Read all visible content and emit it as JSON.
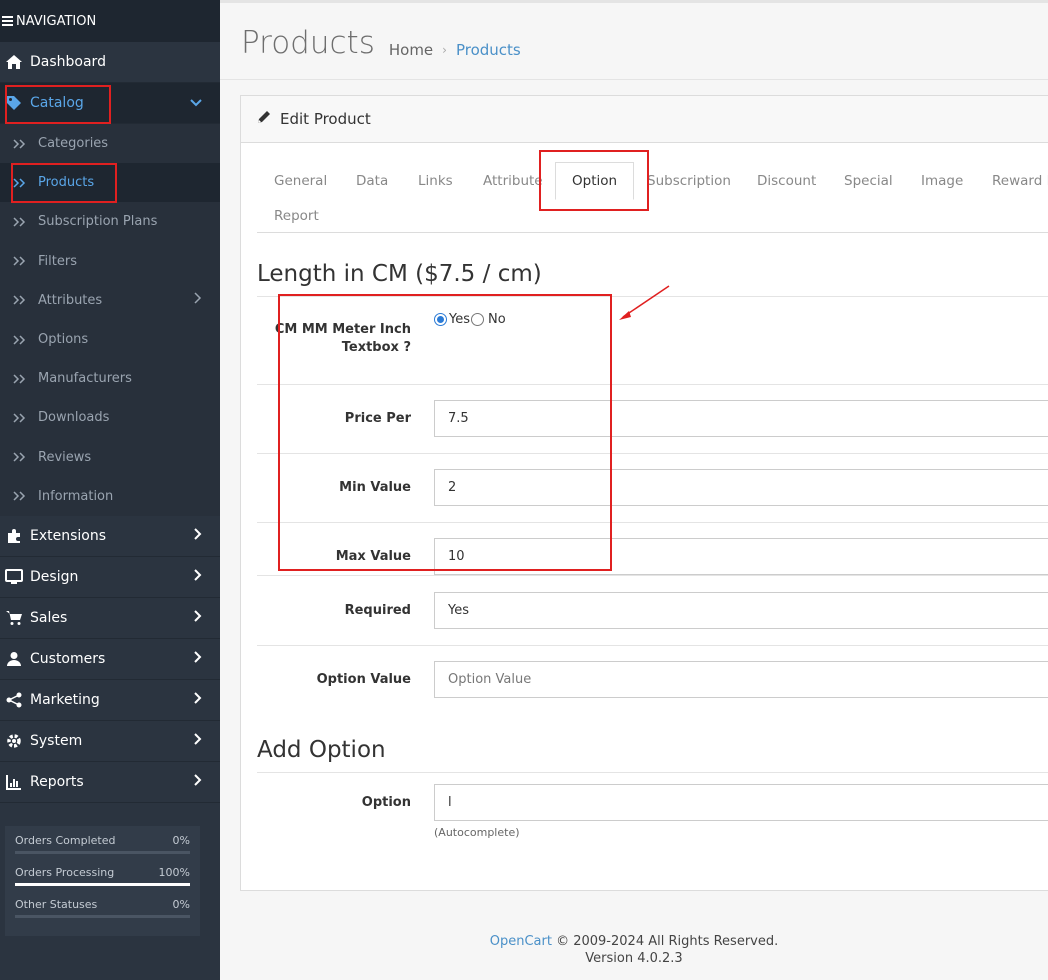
{
  "nav": {
    "header": "NAVIGATION",
    "items": [
      {
        "label": "Dashboard",
        "icon": "home-icon"
      },
      {
        "label": "Catalog",
        "icon": "tag-icon"
      },
      {
        "label": "Extensions",
        "icon": "puzzle-icon"
      },
      {
        "label": "Design",
        "icon": "monitor-icon"
      },
      {
        "label": "Sales",
        "icon": "cart-icon"
      },
      {
        "label": "Customers",
        "icon": "user-icon"
      },
      {
        "label": "Marketing",
        "icon": "share-icon"
      },
      {
        "label": "System",
        "icon": "gear-icon"
      },
      {
        "label": "Reports",
        "icon": "chart-icon"
      }
    ],
    "catalog_sub": [
      {
        "label": "Categories"
      },
      {
        "label": "Products"
      },
      {
        "label": "Subscription Plans"
      },
      {
        "label": "Filters"
      },
      {
        "label": "Attributes"
      },
      {
        "label": "Options"
      },
      {
        "label": "Manufacturers"
      },
      {
        "label": "Downloads"
      },
      {
        "label": "Reviews"
      },
      {
        "label": "Information"
      }
    ],
    "stats": [
      {
        "label": "Orders Completed",
        "value": "0%",
        "fraction": 0
      },
      {
        "label": "Orders Processing",
        "value": "100%",
        "fraction": 1
      },
      {
        "label": "Other Statuses",
        "value": "0%",
        "fraction": 0
      }
    ]
  },
  "header": {
    "title": "Products",
    "breadcrumbs": [
      "Home",
      "Products"
    ]
  },
  "card": {
    "title": "Edit Product",
    "tabs": [
      "General",
      "Data",
      "Links",
      "Attribute",
      "Option",
      "Subscription",
      "Discount",
      "Special",
      "Image",
      "Reward P",
      "Report"
    ],
    "active_tab": "Option"
  },
  "option_section": {
    "title": "Length in CM ($7.5 / cm)",
    "textbox_label": "CM MM Meter Inch Textbox ?",
    "radio_yes": "Yes",
    "radio_no": "No",
    "selected": "Yes",
    "price_label": "Price Per",
    "price_value": "7.5",
    "min_label": "Min Value",
    "min_value": "2",
    "max_label": "Max Value",
    "max_value": "10",
    "required_label": "Required",
    "required_value": "Yes",
    "option_value_label": "Option Value",
    "option_value_placeholder": "Option Value"
  },
  "add_option": {
    "title": "Add Option",
    "label": "Option",
    "value": "l",
    "help": "(Autocomplete)"
  },
  "footer": {
    "link": "OpenCart",
    "copyright": "© 2009-2024 All Rights Reserved.",
    "version": "Version 4.0.2.3"
  },
  "colors": {
    "sidebar_bg": "#2b3440",
    "accent": "#4a90c8",
    "annotation_red": "#e02020"
  }
}
